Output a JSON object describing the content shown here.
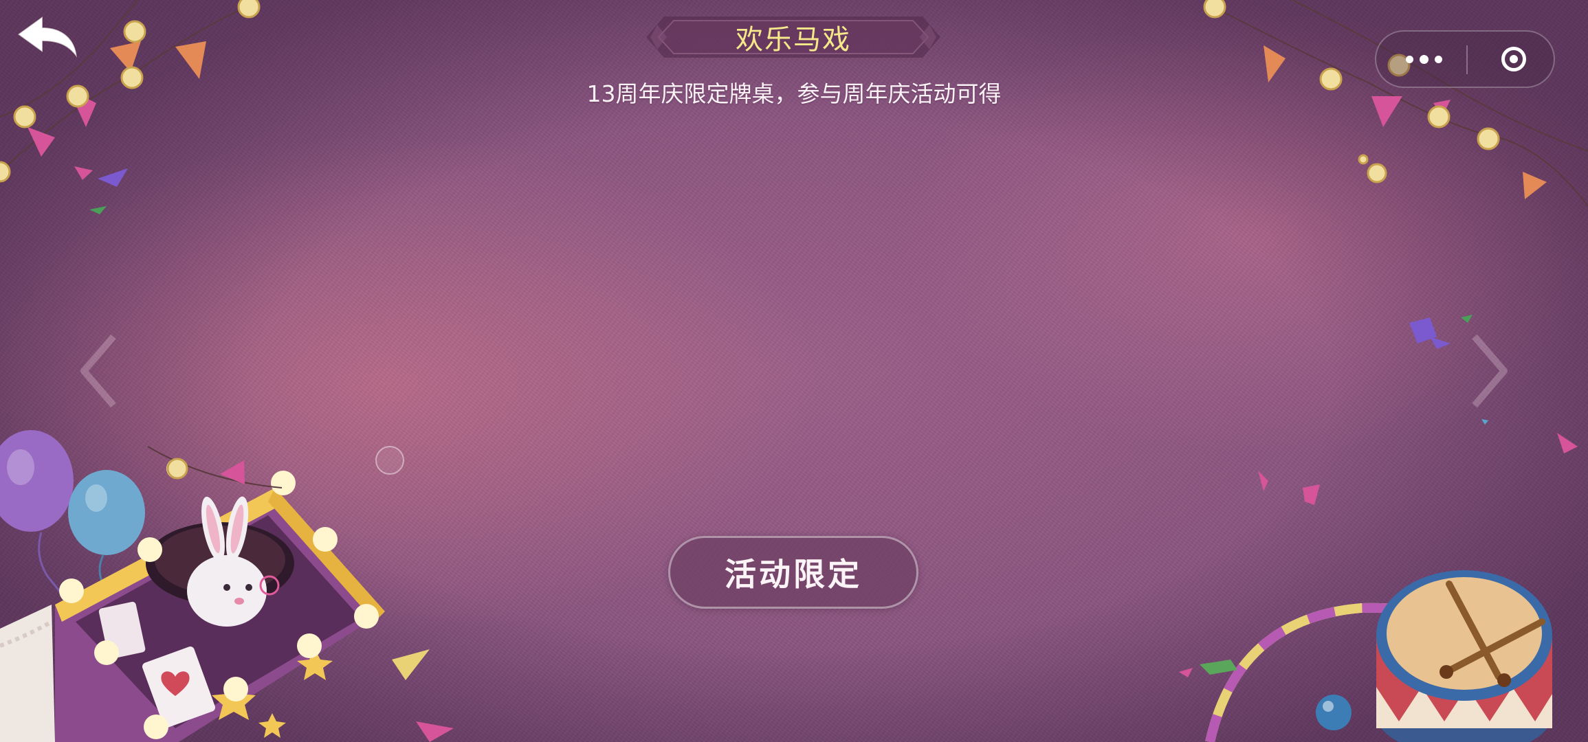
{
  "header": {
    "title": "欢乐马戏",
    "subtitle": "13周年庆限定牌桌，参与周年庆活动可得"
  },
  "badge": {
    "label": "活动限定"
  },
  "icons": {
    "back": "back-arrow-icon",
    "more": "more-dots-icon",
    "close": "target-close-icon",
    "prev": "chevron-left-icon",
    "next": "chevron-right-icon"
  },
  "colors": {
    "title": "#f6e98a",
    "background": "#8a5580",
    "badge_bg": "#6e3e62"
  }
}
